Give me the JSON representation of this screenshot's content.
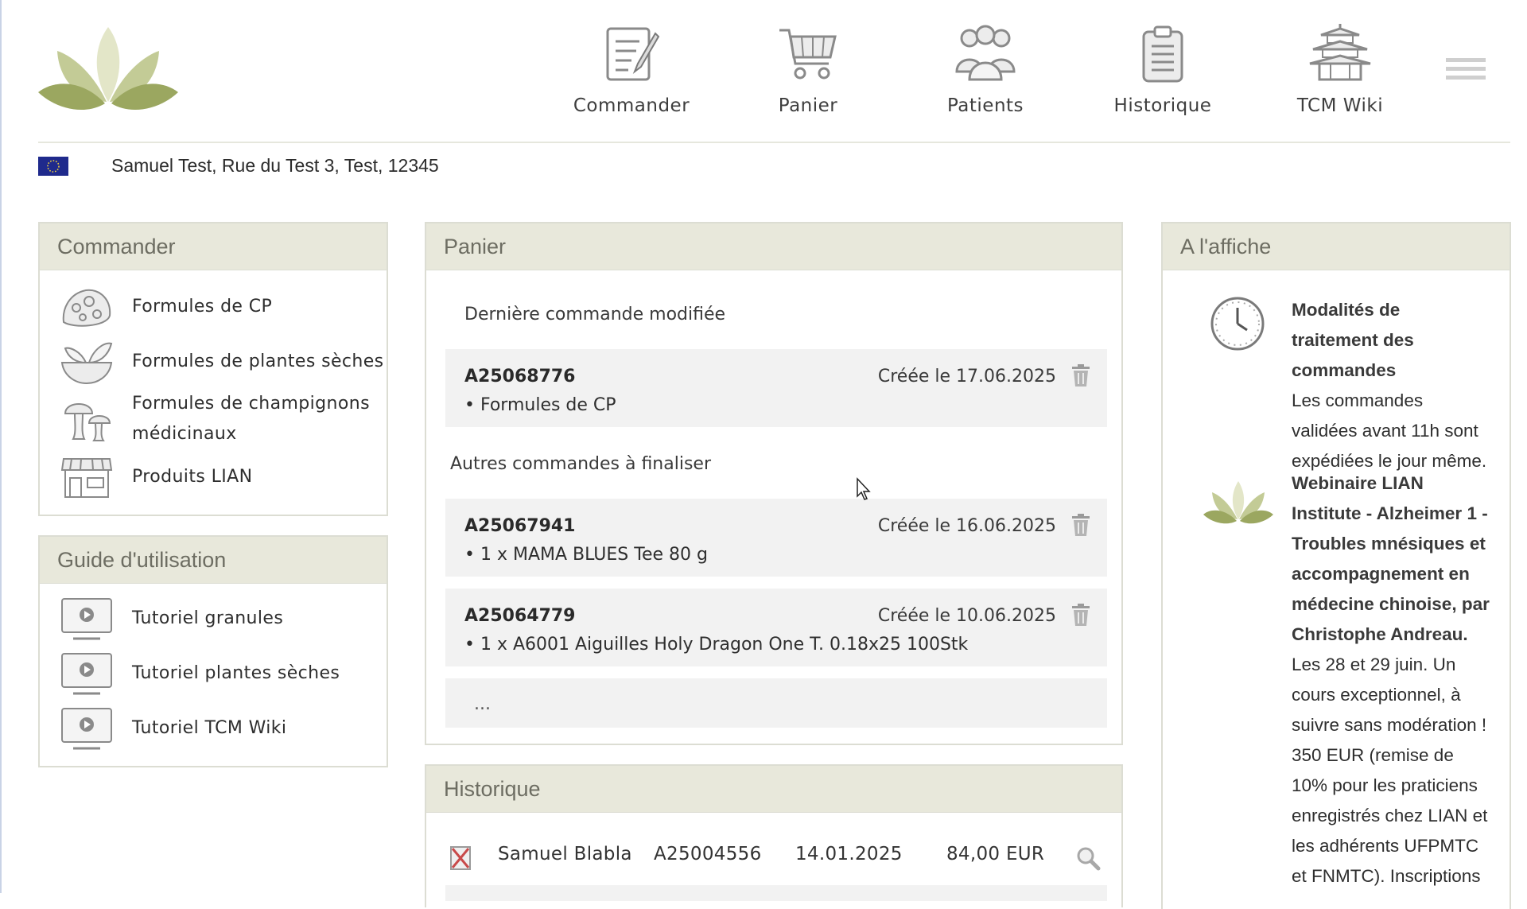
{
  "nav": [
    {
      "label": "Commander",
      "icon": "order-form-icon"
    },
    {
      "label": "Panier",
      "icon": "cart-icon"
    },
    {
      "label": "Patients",
      "icon": "patients-icon"
    },
    {
      "label": "Historique",
      "icon": "clipboard-icon"
    },
    {
      "label": "TCM Wiki",
      "icon": "pagoda-icon"
    }
  ],
  "user": {
    "address": "Samuel Test, Rue du Test 3, Test, 12345"
  },
  "commander": {
    "title": "Commander",
    "items": [
      {
        "label": "Formules de CP",
        "icon": "granules-icon"
      },
      {
        "label": "Formules de plantes sèches",
        "icon": "herb-bowl-icon"
      },
      {
        "label_line1": "Formules de champignons",
        "label_line2": "médicinaux",
        "icon": "mushroom-icon"
      },
      {
        "label": "Produits LIAN",
        "icon": "shop-icon"
      }
    ]
  },
  "guide": {
    "title": "Guide d'utilisation",
    "items": [
      {
        "label": "Tutoriel granules",
        "icon": "video-monitor-icon"
      },
      {
        "label": "Tutoriel plantes sèches",
        "icon": "video-monitor-icon"
      },
      {
        "label": "Tutoriel TCM Wiki",
        "icon": "video-monitor-icon"
      }
    ]
  },
  "panier": {
    "title": "Panier",
    "last_modified_label": "Dernière commande modifiée",
    "other_label": "Autres commandes à finaliser",
    "last_order": {
      "id": "A25068776",
      "date": "Créée le 17.06.2025",
      "line": "• Formules de CP"
    },
    "other_orders": [
      {
        "id": "A25067941",
        "date": "Créée le 16.06.2025",
        "line": "• 1 x  MAMA BLUES Tee 80 g"
      },
      {
        "id": "A25064779",
        "date": "Créée le 10.06.2025",
        "line": "• 1 x  A6001 Aiguilles Holy Dragon One T. 0.18x25 100Stk"
      }
    ],
    "more": "..."
  },
  "historique": {
    "title": "Historique",
    "rows": [
      {
        "name": "Samuel Blabla",
        "id": "A25004556",
        "date": "14.01.2025",
        "amount": "84,00 EUR"
      }
    ]
  },
  "affiche": {
    "title": "A l'affiche",
    "items": [
      {
        "icon": "clock-icon",
        "heading": "Modalités de traitement des commandes",
        "text": "Les commandes validées avant 11h sont expédiées le jour même."
      },
      {
        "icon": "lotus-icon",
        "heading": "Webinaire LIAN Institute - Alzheimer 1 - Troubles mnésiques et accompagnement en médecine chinoise, par Christophe Andreau.",
        "text": "Les 28 et 29 juin. Un cours exceptionnel, à suivre sans modération ! 350 EUR (remise de 10% pour les praticiens enregistrés chez LIAN et les adhérents UFPMTC et FNMTC). Inscriptions"
      }
    ]
  },
  "colors": {
    "panel_header": "#e8e8db",
    "border": "#dcddd3",
    "accent_green": "#9aa862",
    "row_bg": "#f2f2f2"
  }
}
